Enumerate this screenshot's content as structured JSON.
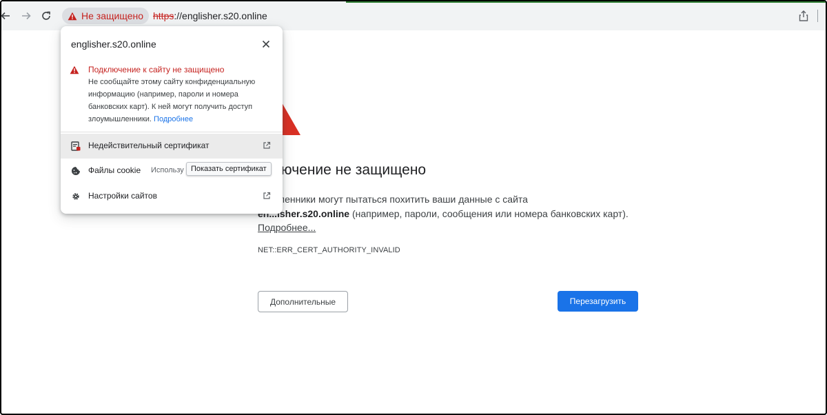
{
  "browser": {
    "security_chip_label": "Не защищено",
    "url_scheme": "https",
    "url_rest": "://englisher.s20.online",
    "colors": {
      "warning": "#c5221f",
      "accent": "#1a73e8"
    }
  },
  "popup": {
    "host": "englisher.s20.online",
    "warning_title": "Подключение к сайту не защищено",
    "warning_body": "Не сообщайте этому сайту конфиденциальную информацию (например, пароли и номера банковских карт). К ней могут получить доступ злоумышленники.",
    "warning_link": "Подробнее",
    "items": [
      {
        "label": "Недействительный сертификат",
        "icon": "certificate-icon"
      },
      {
        "label": "Файлы cookie",
        "sublabel": "Использу",
        "icon": "cookie-icon"
      },
      {
        "label": "Настройки сайтов",
        "icon": "gear-icon"
      }
    ],
    "tooltip": "Показать сертификат"
  },
  "page": {
    "title_visible": "дключение не защищено",
    "desc_line1": "мышленники могут пытаться похитить ваши данные с сайта",
    "desc_host_visible": "en...isher.s20.online",
    "desc_line2": " (например, пароли, сообщения или номера банковских карт).",
    "more_link": "Подробнее...",
    "error_code": "NET::ERR_CERT_AUTHORITY_INVALID",
    "advanced_button": "Дополнительные",
    "reload_button": "Перезагрузить"
  }
}
